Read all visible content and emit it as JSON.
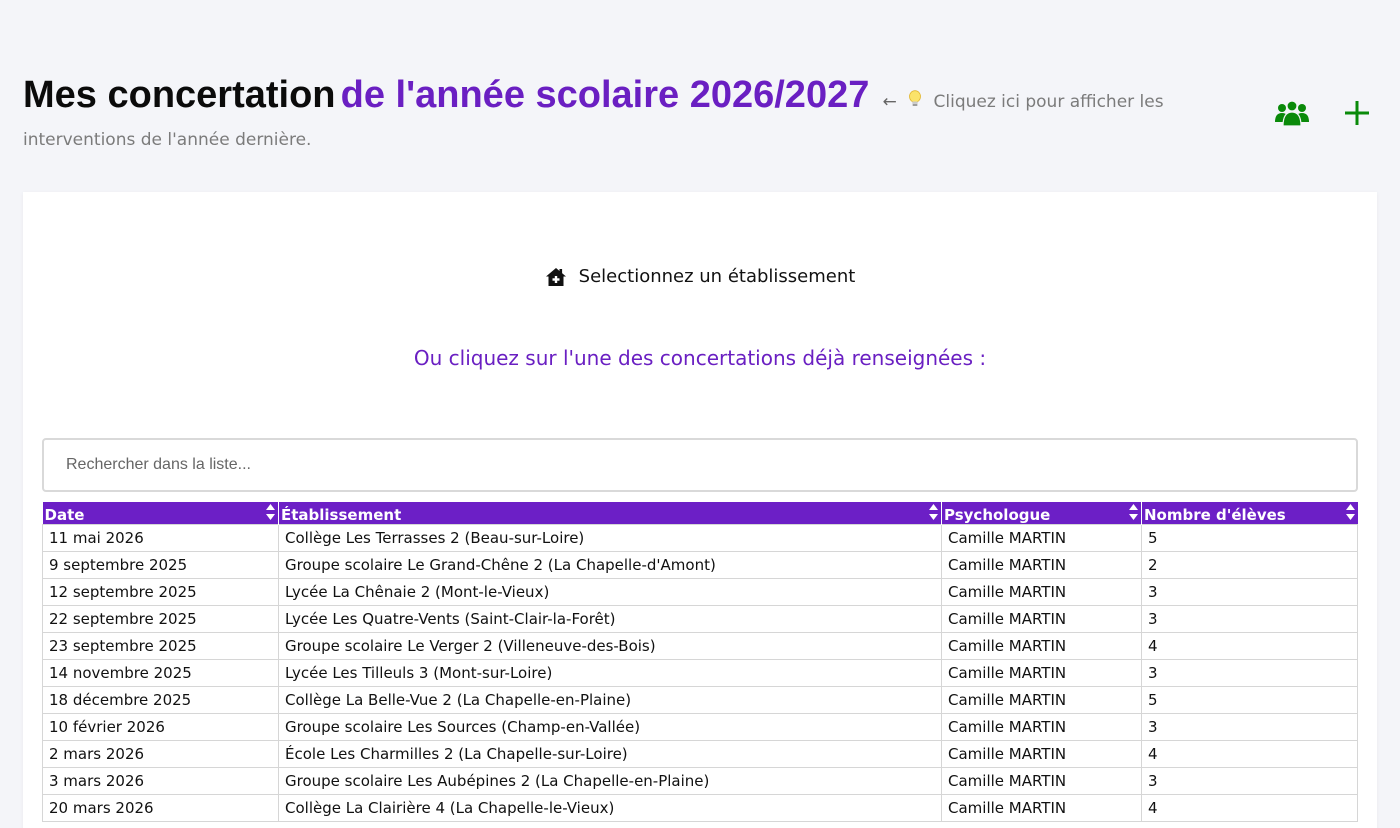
{
  "header": {
    "title_main": "Mes concertation",
    "title_accent": "de l'année scolaire 2026/2027",
    "arrow": "←",
    "hint_line1": "Cliquez ici pour afficher les",
    "hint_line2": "interventions de l'année dernière."
  },
  "actions": {
    "group_icon": "users-group-icon",
    "add_icon": "plus-icon",
    "accent_color": "#0a8a0a"
  },
  "card": {
    "select_label": "Selectionnez un établissement",
    "subtitle": "Ou cliquez sur l'une des concertations déjà renseignées :",
    "search_placeholder": "Rechercher dans la liste..."
  },
  "table": {
    "columns": [
      "Date",
      "Établissement",
      "Psychologue",
      "Nombre d'élèves"
    ],
    "rows": [
      [
        "11 mai 2026",
        "Collège Les Terrasses 2 (Beau-sur-Loire)",
        "Camille MARTIN",
        "5"
      ],
      [
        "9 septembre 2025",
        "Groupe scolaire Le Grand-Chêne 2 (La Chapelle-d'Amont)",
        "Camille MARTIN",
        "2"
      ],
      [
        "12 septembre 2025",
        "Lycée La Chênaie 2 (Mont-le-Vieux)",
        "Camille MARTIN",
        "3"
      ],
      [
        "22 septembre 2025",
        "Lycée Les Quatre-Vents (Saint-Clair-la-Forêt)",
        "Camille MARTIN",
        "3"
      ],
      [
        "23 septembre 2025",
        "Groupe scolaire Le Verger 2 (Villeneuve-des-Bois)",
        "Camille MARTIN",
        "4"
      ],
      [
        "14 novembre 2025",
        "Lycée Les Tilleuls 3 (Mont-sur-Loire)",
        "Camille MARTIN",
        "3"
      ],
      [
        "18 décembre 2025",
        "Collège La Belle-Vue 2 (La Chapelle-en-Plaine)",
        "Camille MARTIN",
        "5"
      ],
      [
        "10 février 2026",
        "Groupe scolaire Les Sources (Champ-en-Vallée)",
        "Camille MARTIN",
        "3"
      ],
      [
        "2 mars 2026",
        "École Les Charmilles 2 (La Chapelle-sur-Loire)",
        "Camille MARTIN",
        "4"
      ],
      [
        "3 mars 2026",
        "Groupe scolaire Les Aubépines 2 (La Chapelle-en-Plaine)",
        "Camille MARTIN",
        "3"
      ],
      [
        "20 mars 2026",
        "Collège La Clairière 4 (La Chapelle-le-Vieux)",
        "Camille MARTIN",
        "4"
      ]
    ]
  }
}
